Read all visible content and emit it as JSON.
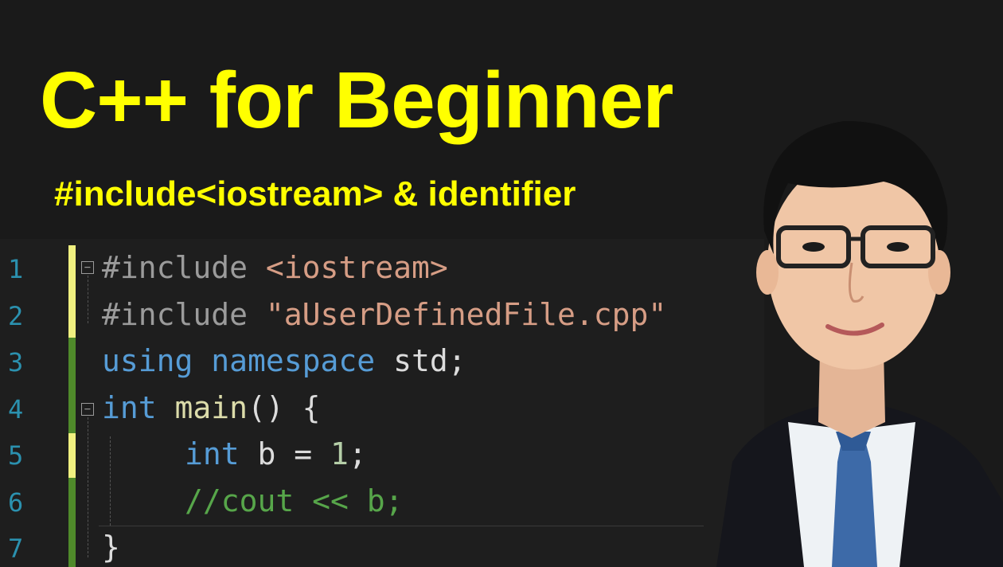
{
  "title": "C++ for Beginner",
  "subtitle": "#include<iostream> & identifier",
  "editor": {
    "line_numbers": [
      "1",
      "2",
      "3",
      "4",
      "5",
      "6",
      "7"
    ],
    "code": {
      "l1_dir": "#include",
      "l1_arg": "<iostream>",
      "l2_dir": "#include",
      "l2_arg": "\"aUserDefinedFile.cpp\"",
      "l3_kw1": "using",
      "l3_kw2": "namespace",
      "l3_ns": "std;",
      "l4_kw": "int",
      "l4_fn": "main",
      "l4_rest": "() {",
      "l5_kw": "int",
      "l5_rest": " b = ",
      "l5_num": "1",
      "l5_end": ";",
      "l6_cmt": "//cout << b;",
      "l7": "}"
    }
  },
  "colors": {
    "accent": "#ffff00",
    "keyword": "#569cd6",
    "string": "#d69d85",
    "comment": "#57a64a",
    "linenumber": "#2b91af"
  }
}
